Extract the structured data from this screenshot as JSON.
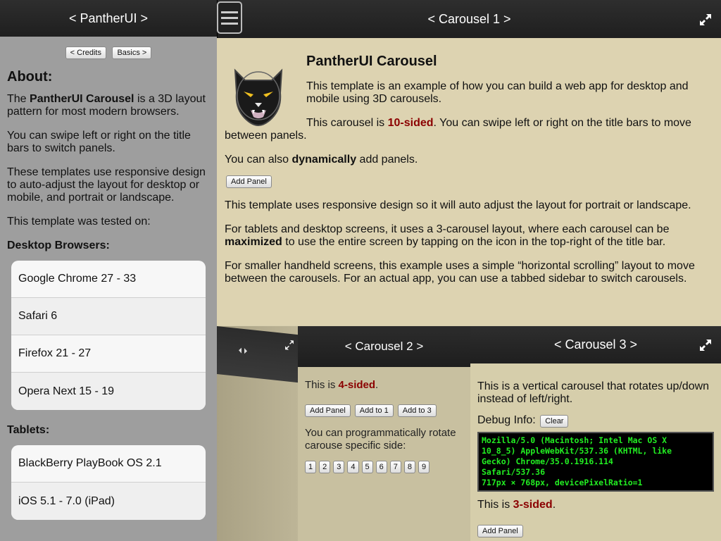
{
  "sidebar": {
    "title": "< PantherUI >",
    "credits_button": "< Credits",
    "basics_button": "Basics >",
    "about_heading": "About:",
    "p1_pre": "The ",
    "p1_bold": "PantherUI Carousel",
    "p1_post": " is a 3D layout pattern for most modern browsers.",
    "p2": "You can swipe left or right on the title bars to switch panels.",
    "p3": "These templates use responsive design to auto-adjust the layout for desktop or mobile, and portrait or landscape.",
    "p4": "This template was tested on:",
    "desktop_heading": "Desktop Browsers:",
    "desktop_items": [
      "Google Chrome 27 - 33",
      "Safari 6",
      "Firefox 21 - 27",
      "Opera Next 15 - 19"
    ],
    "tablets_heading": "Tablets:",
    "tablet_items": [
      "BlackBerry PlayBook OS 2.1",
      "iOS 5.1 - 7.0 (iPad)"
    ]
  },
  "carousel1": {
    "title": "< Carousel 1 >",
    "heading": "PantherUI Carousel",
    "p1": "This template is an example of how you can build a web app for desktop and mobile using 3D carousels.",
    "p2_pre": "This carousel is ",
    "p2_red": "10-sided",
    "p2_post": ". You can swipe left or right on the title bars to move between panels.",
    "p3_pre": "You can also ",
    "p3_bold": "dynamically",
    "p3_post": " add panels.",
    "add_panel": "Add Panel",
    "p4": "This template uses responsive design so it will auto adjust the layout for portrait or landscape.",
    "p5_pre": "For tablets and desktop screens, it uses a 3-carousel layout, where each carousel can be ",
    "p5_bold": "maximized",
    "p5_post": " to use the entire screen by tapping on the icon in the top-right of the title bar.",
    "p6": "For smaller handheld screens, this example uses a simple “horizontal scrolling” layout to move between the carousels. For an actual app, you can use a tabbed sidebar to switch carousels."
  },
  "carousel2": {
    "title": "< Carousel 2 >",
    "p1_pre": "This is ",
    "p1_red": "4-sided",
    "p1_post": ".",
    "add_panel": "Add Panel",
    "add_to_1": "Add to 1",
    "add_to_3": "Add to 3",
    "p2": "You can programmatically rotate carouse specific side:",
    "numbers": [
      "1",
      "2",
      "3",
      "4",
      "5",
      "6",
      "7",
      "8",
      "9"
    ]
  },
  "carousel3": {
    "title": "< Carousel 3 >",
    "p1": "This is a vertical carousel that rotates up/down instead of left/right.",
    "debug_label": "Debug Info:",
    "clear_button": "Clear",
    "debug_lines": [
      "Mozilla/5.0 (Macintosh; Intel Mac OS X",
      "10_8_5) AppleWebKit/537.36 (KHTML, like",
      "Gecko) Chrome/35.0.1916.114",
      "Safari/537.36",
      "717px × 768px, devicePixelRatio=1"
    ],
    "p2_pre": "This is ",
    "p2_red": "3-sided",
    "p2_post": ".",
    "add_panel": "Add Panel"
  }
}
